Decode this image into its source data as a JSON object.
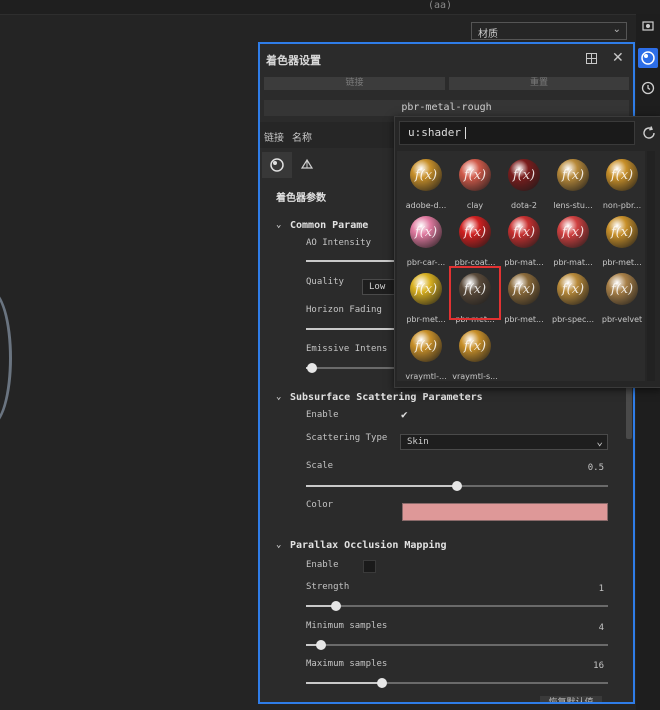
{
  "topbar": {
    "ghost_text_1": "(aa)",
    "material_dropdown": "材质"
  },
  "panel": {
    "title": "着色器设置",
    "btn_left": "链接",
    "btn_right": "重置",
    "shader_name": "pbr-metal-rough",
    "tab_link": "链接",
    "tab_name": "名称",
    "section_title": "着色器参数",
    "reset_button": "恢复默认值"
  },
  "common": {
    "title": "Common Parame",
    "ao_label": "AO Intensity",
    "quality_label": "Quality",
    "quality_value": "Low",
    "horizon_label": "Horizon Fading",
    "emissive_label": "Emissive Intens"
  },
  "sss": {
    "title": "Subsurface Scattering Parameters",
    "enable_label": "Enable",
    "enable_checked": true,
    "scattering_type_label": "Scattering Type",
    "scattering_type_value": "Skin",
    "scale_label": "Scale",
    "scale_value": "0.5",
    "scale_fraction": 0.5,
    "color_label": "Color",
    "color_value": "#de9898"
  },
  "pom": {
    "title": "Parallax Occlusion Mapping",
    "enable_label": "Enable",
    "enable_checked": false,
    "strength_label": "Strength",
    "strength_value": "1",
    "strength_fraction": 0.1,
    "min_label": "Minimum samples",
    "min_value": "4",
    "min_fraction": 0.05,
    "max_label": "Maximum samples",
    "max_value": "16",
    "max_fraction": 0.25
  },
  "popup": {
    "search_value": "u:shader",
    "materials": [
      {
        "label": "adobe-d...",
        "color": "#c8902a",
        "selected": false
      },
      {
        "label": "clay",
        "color": "#d05a4a",
        "selected": false
      },
      {
        "label": "dota-2",
        "color": "#7a1c1c",
        "selected": false
      },
      {
        "label": "lens-stu...",
        "color": "#b88a3a",
        "selected": false
      },
      {
        "label": "non-pbr...",
        "color": "#c8902a",
        "selected": false
      },
      {
        "label": "pbr-car-...",
        "color": "#e07aa0",
        "selected": false
      },
      {
        "label": "pbr-coat...",
        "color": "#d02020",
        "selected": false
      },
      {
        "label": "pbr-mat...",
        "color": "#c83030",
        "selected": false
      },
      {
        "label": "pbr-mat...",
        "color": "#d04040",
        "selected": false
      },
      {
        "label": "pbr-met...",
        "color": "#c8902a",
        "selected": false
      },
      {
        "label": "pbr-met...",
        "color": "#d8b020",
        "selected": false
      },
      {
        "label": "pbr-met...",
        "color": "#5a4a3a",
        "selected": true
      },
      {
        "label": "pbr-met...",
        "color": "#8a6a3a",
        "selected": false
      },
      {
        "label": "pbr-spec...",
        "color": "#b88a3a",
        "selected": false
      },
      {
        "label": "pbr-velvet",
        "color": "#a88048",
        "selected": false
      },
      {
        "label": "vraymtl-...",
        "color": "#c8902a",
        "selected": false
      },
      {
        "label": "vraymtl-s...",
        "color": "#c8902a",
        "selected": false
      }
    ]
  }
}
